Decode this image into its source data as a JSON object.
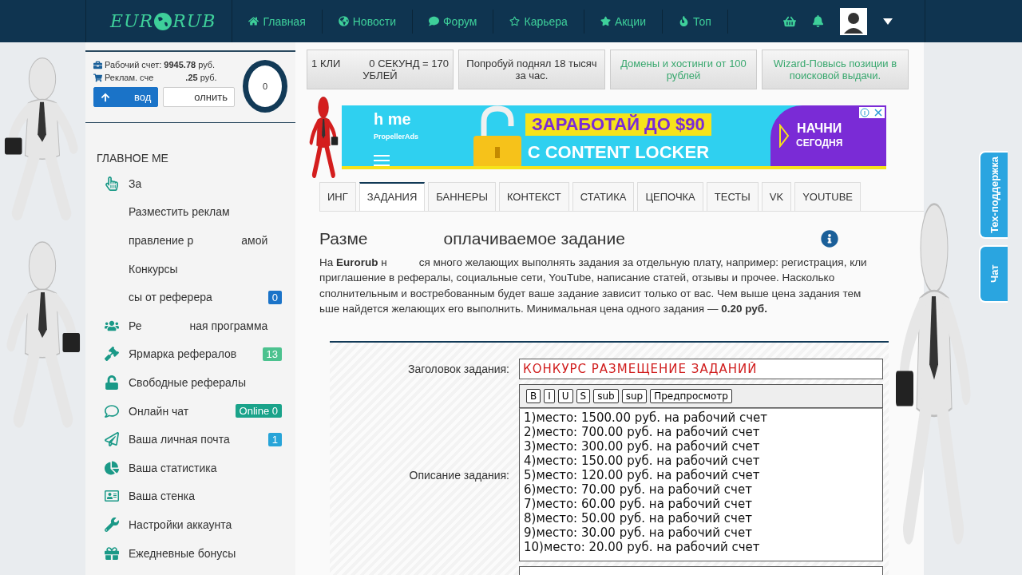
{
  "header": {
    "logo": {
      "left": "EUR",
      "right": "RUB"
    },
    "nav": [
      {
        "label": "Главная"
      },
      {
        "label": "Новости"
      },
      {
        "label": "Форум"
      },
      {
        "label": "Карьера"
      },
      {
        "label": "Акции"
      },
      {
        "label": "Топ"
      }
    ]
  },
  "sidebar": {
    "account": {
      "lines": [
        [
          "Рабочий счет: **9945.78** руб."
        ],
        [
          "Реклам. сче",
          "**.25** руб."
        ]
      ],
      "buttons": [
        {
          "label": "вод",
          "kind": "primary"
        },
        {
          "label": "олнить",
          "kind": "default"
        }
      ],
      "donut": "0"
    },
    "menu_title": "ГЛАВНОЕ МЕ",
    "menu": [
      {
        "parts": [
          "За"
        ]
      },
      {
        "parts": [
          "Разместить реклам"
        ]
      },
      {
        "parts": [
          "правление р",
          "амой"
        ]
      },
      {
        "parts": [
          "Конкурсы"
        ]
      },
      {
        "parts": [
          "сы от реферера"
        ],
        "badge": "0",
        "color": "#1a73c8"
      },
      {
        "parts": [
          "Ре",
          "ная программа"
        ]
      },
      {
        "parts": [
          "Ярмарка рефералов"
        ],
        "badge": "13",
        "color": "#4cc28f"
      },
      {
        "parts": [
          "Свободные рефералы"
        ]
      },
      {
        "parts": [
          "Онлайн чат"
        ],
        "badge": "Online 0",
        "color": "#1aa38a"
      },
      {
        "parts": [
          "Ваша личная почта"
        ],
        "badge": "1",
        "color": "#27a4d8"
      },
      {
        "parts": [
          "Ваша статистика"
        ]
      },
      {
        "parts": [
          "Ваша стенка"
        ]
      },
      {
        "parts": [
          "Настройки аккаунта"
        ]
      },
      {
        "parts": [
          "Ежедневные бонусы"
        ]
      }
    ]
  },
  "ads": [
    {
      "lines": [
        [
          "1 КЛИ",
          "0 СЕКУНД = 170"
        ],
        [
          "УБЛЕЙ"
        ]
      ],
      "color": "#333333"
    },
    {
      "lines": [
        [
          "Попробуй поднял 18 тысяч"
        ],
        [
          "за час."
        ]
      ],
      "color": "#333333"
    },
    {
      "lines": [
        [
          "Домены и хостинги от 100"
        ],
        [
          "рублей"
        ]
      ],
      "color": "#3aa86f"
    },
    {
      "lines": [
        [
          "Wizard-Повысь позиции в"
        ],
        [
          "поисковой выдачи."
        ]
      ],
      "color": "#3aa86f"
    }
  ],
  "banner": {
    "brand": "h me",
    "brand_sub": "PropellerAds",
    "headline": "ЗАРАБОТАЙ ДО $90",
    "subline": "С CONTENT LOCKER",
    "cta": [
      "НАЧНИ",
      "СЕГОДНЯ"
    ]
  },
  "tabs": [
    {
      "label": "ИНГ",
      "selected": false
    },
    {
      "label": "ЗАДАНИЯ",
      "selected": true
    },
    {
      "label": "БАННЕРЫ",
      "selected": false
    },
    {
      "label": "КОНТЕКСТ",
      "selected": false
    },
    {
      "label": "СТАТИКА",
      "selected": false
    },
    {
      "label": "ЦЕПОЧКА",
      "selected": false
    },
    {
      "label": "ТЕСТЫ",
      "selected": false
    },
    {
      "label": "VK",
      "selected": false
    },
    {
      "label": "YOUTUBE",
      "selected": false
    }
  ],
  "heading": [
    "Разме",
    "оплачиваемое задание"
  ],
  "intro": [
    [
      "На **Eurorub** н",
      "ся много желающих выполнять задания за отдельную плату, например: регистрация, кли"
    ],
    [
      "приглашение в рефералы, социальные сети, YouTube, написание статей, отзывы и прочее. Насколько"
    ],
    [
      "сполнительным и востребованным будет ваше задание зависит только от вас. Чем выше цена задания тем"
    ],
    [
      "ьше найдется желающих его выполнить. Минимальная цена одного задания — **0.20 руб.**"
    ]
  ],
  "form": {
    "title_label": "Заголовок задания:",
    "title_value": "КОНКУРС РАЗМЕЩЕНИЕ ЗАДАНИЙ",
    "toolbar": [
      "B",
      "I",
      "U",
      "S",
      "sub",
      "sup",
      "Предпросмотр"
    ],
    "description_label": "Описание задания:",
    "description_lines": [
      "1)место: 1500.00 руб. на рабочий счет",
      "2)место: 700.00 руб. на рабочий счет",
      "3)место: 300.00 руб. на рабочий счет",
      "4)место: 150.00 руб. на рабочий счет",
      "5)место: 120.00 руб. на рабочий счет",
      "6)место: 70.00 руб. на рабочий счет",
      "7)место: 60.00 руб. на рабочий счет",
      "8)место: 50.00 руб. на рабочий счет",
      "9)место: 30.00 руб. на рабочий счет",
      "10)место: 20.00 руб. на рабочий счет"
    ]
  },
  "side_tabs": [
    {
      "label": "Тех-поддержка"
    },
    {
      "label": "Чат"
    }
  ]
}
